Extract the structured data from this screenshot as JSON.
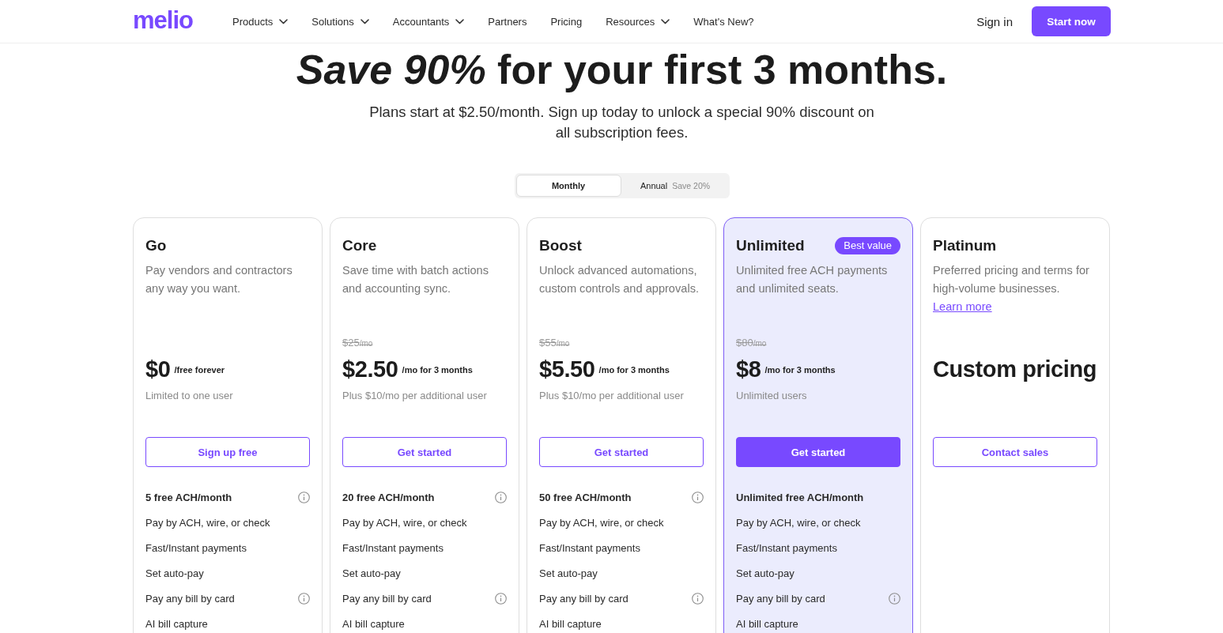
{
  "header": {
    "logo": "melio",
    "nav": [
      {
        "label": "Products",
        "has_menu": true
      },
      {
        "label": "Solutions",
        "has_menu": true
      },
      {
        "label": "Accountants",
        "has_menu": true
      },
      {
        "label": "Partners",
        "has_menu": false
      },
      {
        "label": "Pricing",
        "has_menu": false
      },
      {
        "label": "Resources",
        "has_menu": true
      },
      {
        "label": "What's New?",
        "has_menu": false
      }
    ],
    "sign_in": "Sign in",
    "cta": "Start now"
  },
  "hero": {
    "title": "*Save 90%* for your first 3 months.",
    "subtitle": "Plans start at $2.50/month. Sign up today to unlock a special 90% discount on all subscription fees."
  },
  "billing_toggle": [
    {
      "label": "Monthly",
      "selected": true
    },
    {
      "label": "Annual",
      "note": "Save 20%",
      "selected": false
    }
  ],
  "plans": [
    {
      "name": "Go",
      "highlighted": false,
      "description": "Pay vendors and contractors any way you want.",
      "price": "$0",
      "price_suffix": "/free forever",
      "note": "Limited to one user",
      "button": {
        "label": "Sign up free",
        "primary": false
      },
      "features": [
        {
          "label": "5 free ACH/month",
          "bold": true,
          "info": true
        },
        {
          "label": "Pay by ACH, wire, or check",
          "bold": false,
          "info": false
        },
        {
          "label": "Fast/Instant payments",
          "bold": false,
          "info": false
        },
        {
          "label": "Set auto-pay",
          "bold": false,
          "info": false
        },
        {
          "label": "Pay any bill by card",
          "bold": false,
          "info": true
        },
        {
          "label": "AI bill capture",
          "bold": false,
          "info": false
        }
      ]
    },
    {
      "name": "Core",
      "highlighted": false,
      "description": "Save time with batch actions and accounting sync.",
      "old_price": "$25",
      "old_price_suffix": "/mo",
      "price": "$2.50",
      "price_suffix": "/mo for 3 months",
      "note": "Plus $10/mo per additional user",
      "button": {
        "label": "Get started",
        "primary": false
      },
      "features": [
        {
          "label": "20 free ACH/month",
          "bold": true,
          "info": true
        },
        {
          "label": "Pay by ACH, wire, or check",
          "bold": false,
          "info": false
        },
        {
          "label": "Fast/Instant payments",
          "bold": false,
          "info": false
        },
        {
          "label": "Set auto-pay",
          "bold": false,
          "info": false
        },
        {
          "label": "Pay any bill by card",
          "bold": false,
          "info": true
        },
        {
          "label": "AI bill capture",
          "bold": false,
          "info": false
        }
      ]
    },
    {
      "name": "Boost",
      "highlighted": false,
      "description": "Unlock advanced automations, custom controls and approvals.",
      "old_price": "$55",
      "old_price_suffix": "/mo",
      "price": "$5.50",
      "price_suffix": "/mo for 3 months",
      "note": "Plus $10/mo per additional user",
      "button": {
        "label": "Get started",
        "primary": false
      },
      "features": [
        {
          "label": "50 free ACH/month",
          "bold": true,
          "info": true
        },
        {
          "label": "Pay by ACH, wire, or check",
          "bold": false,
          "info": false
        },
        {
          "label": "Fast/Instant payments",
          "bold": false,
          "info": false
        },
        {
          "label": "Set auto-pay",
          "bold": false,
          "info": false
        },
        {
          "label": "Pay any bill by card",
          "bold": false,
          "info": true
        },
        {
          "label": "AI bill capture",
          "bold": false,
          "info": false
        }
      ]
    },
    {
      "name": "Unlimited",
      "badge": "Best value",
      "highlighted": true,
      "description": "Unlimited free ACH payments and unlimited seats.",
      "old_price": "$80",
      "old_price_suffix": "/mo",
      "price": "$8",
      "price_suffix": "/mo for 3 months",
      "note": "Unlimited users",
      "button": {
        "label": "Get started",
        "primary": true
      },
      "features": [
        {
          "label": "Unlimited free ACH/month",
          "bold": true,
          "info": false
        },
        {
          "label": "Pay by ACH, wire, or check",
          "bold": false,
          "info": false
        },
        {
          "label": "Fast/Instant payments",
          "bold": false,
          "info": false
        },
        {
          "label": "Set auto-pay",
          "bold": false,
          "info": false
        },
        {
          "label": "Pay any bill by card",
          "bold": false,
          "info": true
        },
        {
          "label": "AI bill capture",
          "bold": false,
          "info": false
        }
      ]
    },
    {
      "name": "Platinum",
      "highlighted": false,
      "description": "Preferred pricing and terms for high-volume businesses.",
      "description_link": "Learn more",
      "price": "Custom pricing",
      "button": {
        "label": "Contact sales",
        "primary": false
      }
    }
  ]
}
